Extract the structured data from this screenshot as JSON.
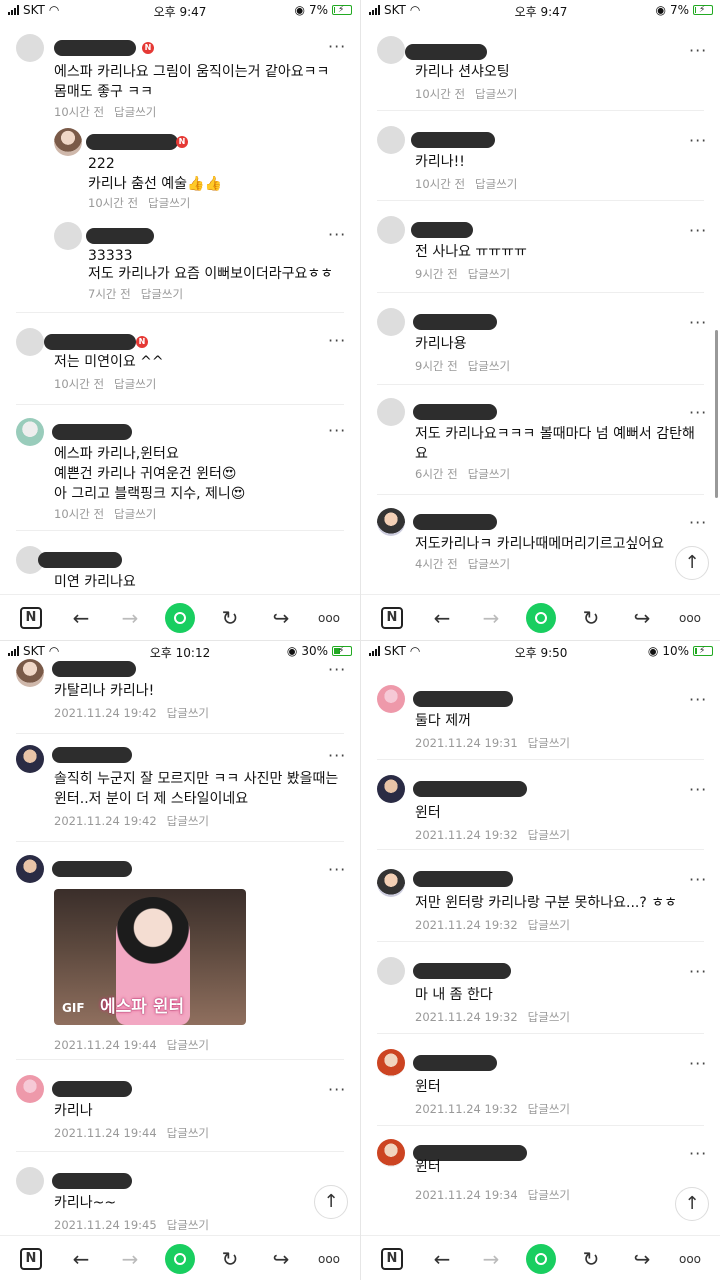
{
  "panels": [
    {
      "status": {
        "carrier": "SKT",
        "time": "오후 9:47",
        "battery": "7%",
        "battery_level": 0.07
      },
      "comments": [
        {
          "lines": [
            "에스파 카리나요 그림이 움직이는거 같아요ㅋㅋ",
            "몸매도 좋구 ㅋㅋ"
          ],
          "time": "10시간 전",
          "reply": "답글쓰기",
          "badge": "N"
        },
        {
          "lines": [
            "222",
            "카리나 춤선 예술👍👍"
          ],
          "time": "10시간 전",
          "reply": "답글쓰기",
          "badge": "N"
        },
        {
          "lines": [
            "33333",
            "저도 카리나가 요즘 이뻐보이더라구요ㅎㅎ"
          ],
          "time": "7시간 전",
          "reply": "답글쓰기"
        },
        {
          "lines": [
            "저는 미연이요 ^^"
          ],
          "time": "10시간 전",
          "reply": "답글쓰기",
          "badge": "N"
        },
        {
          "lines": [
            "에스파 카리나,윈터요",
            "예쁜건 카리나 귀여운건 윈터😍",
            "아 그리고 블랙핑크 지수, 제니😍"
          ],
          "time": "10시간 전",
          "reply": "답글쓰기"
        },
        {
          "lines": [
            "미연 카리나요"
          ]
        }
      ]
    },
    {
      "status": {
        "carrier": "SKT",
        "time": "오후 9:47",
        "battery": "7%",
        "battery_level": 0.07
      },
      "comments": [
        {
          "lines": [
            "카리나 션샤오팅"
          ],
          "time": "10시간 전",
          "reply": "답글쓰기"
        },
        {
          "lines": [
            "카리나!!"
          ],
          "time": "10시간 전",
          "reply": "답글쓰기"
        },
        {
          "lines": [
            "전 사나요 ㅠㅠㅠㅠ"
          ],
          "time": "9시간 전",
          "reply": "답글쓰기"
        },
        {
          "lines": [
            "카리나용"
          ],
          "time": "9시간 전",
          "reply": "답글쓰기"
        },
        {
          "lines": [
            "저도 카리나요ㅋㅋㅋ 볼때마다 넘 예뻐서 감탄해",
            "요"
          ],
          "time": "6시간 전",
          "reply": "답글쓰기"
        },
        {
          "lines": [
            "저도카리나ㅋ 카리나때메머리기르고싶어요"
          ],
          "time": "4시간 전",
          "reply": "답글쓰기"
        }
      ]
    },
    {
      "status": {
        "carrier": "SKT",
        "time": "오후 10:12",
        "battery": "30%",
        "battery_level": 0.3
      },
      "comments": [
        {
          "lines": [
            "카탈리나 카리나!"
          ],
          "time": "2021.11.24 19:42",
          "reply": "답글쓰기"
        },
        {
          "lines": [
            "솔직히 누군지 잘 모르지만 ㅋㅋ 사진만 봤을때는",
            "윈터..저 분이 더 제 스타일이네요"
          ],
          "time": "2021.11.24 19:42",
          "reply": "답글쓰기"
        },
        {
          "lines": [],
          "gif_tag": "GIF",
          "gif_caption": "에스파 윈터",
          "time": "2021.11.24 19:44",
          "reply": "답글쓰기"
        },
        {
          "lines": [
            "카리나"
          ],
          "time": "2021.11.24 19:44",
          "reply": "답글쓰기"
        },
        {
          "lines": [
            "카리나~~"
          ],
          "time": "2021.11.24 19:45",
          "reply": "답글쓰기"
        }
      ]
    },
    {
      "status": {
        "carrier": "SKT",
        "time": "오후 9:50",
        "battery": "10%",
        "battery_level": 0.1
      },
      "comments": [
        {
          "lines": [
            "둘다 제꺼"
          ],
          "time": "2021.11.24 19:31",
          "reply": "답글쓰기"
        },
        {
          "lines": [
            "윈터"
          ],
          "time": "2021.11.24 19:32",
          "reply": "답글쓰기"
        },
        {
          "lines": [
            "저만 윈터랑 카리나랑 구분 못하나요...? ㅎㅎ"
          ],
          "time": "2021.11.24 19:32",
          "reply": "답글쓰기"
        },
        {
          "lines": [
            "마 내 좀 한다"
          ],
          "time": "2021.11.24 19:32",
          "reply": "답글쓰기"
        },
        {
          "lines": [
            "윈터"
          ],
          "time": "2021.11.24 19:32",
          "reply": "답글쓰기"
        },
        {
          "lines": [
            "윈터"
          ],
          "time": "2021.11.24 19:34",
          "reply": "답글쓰기"
        }
      ]
    }
  ],
  "toolbar": {
    "n_label": "N",
    "back": "←",
    "forward": "→",
    "reload": "↻",
    "share": "↪",
    "more": "ooo"
  },
  "fab": {
    "label": "↑"
  },
  "colors": {
    "accent": "#19ce60",
    "badge": "#e53935",
    "meta": "#999999"
  }
}
